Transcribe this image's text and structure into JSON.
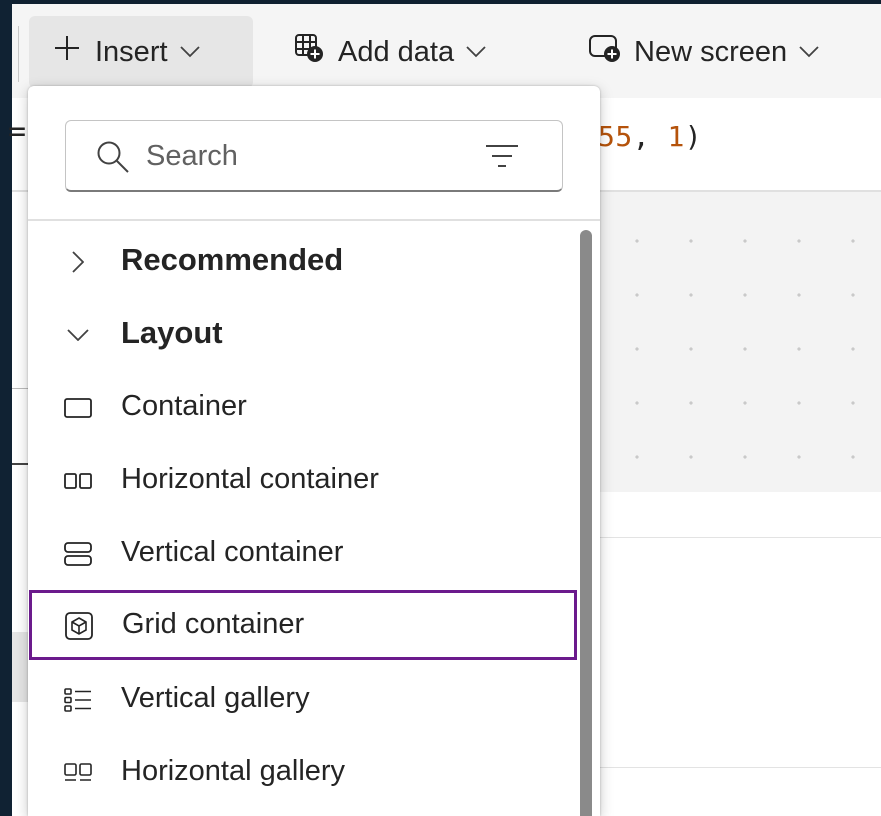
{
  "toolbar": {
    "insert_label": "Insert",
    "add_data_label": "Add data",
    "new_screen_label": "New screen"
  },
  "formula": {
    "eq": "=",
    "num_a": "55",
    "sep": ", ",
    "num_b": "1",
    "close": ")"
  },
  "search": {
    "placeholder": "Search"
  },
  "menu": {
    "categories": [
      {
        "label": "Recommended",
        "expanded": false
      },
      {
        "label": "Layout",
        "expanded": true
      }
    ],
    "items": [
      {
        "label": "Container",
        "icon": "container-icon"
      },
      {
        "label": "Horizontal container",
        "icon": "horizontal-container-icon"
      },
      {
        "label": "Vertical container",
        "icon": "vertical-container-icon"
      },
      {
        "label": "Grid container",
        "icon": "grid-container-icon",
        "selected": true
      },
      {
        "label": "Vertical gallery",
        "icon": "vertical-gallery-icon"
      },
      {
        "label": "Horizontal gallery",
        "icon": "horizontal-gallery-icon"
      }
    ]
  },
  "colors": {
    "selection_border": "#6b1a8c",
    "add_badge": "#242424",
    "code_number": "#b5530b"
  }
}
